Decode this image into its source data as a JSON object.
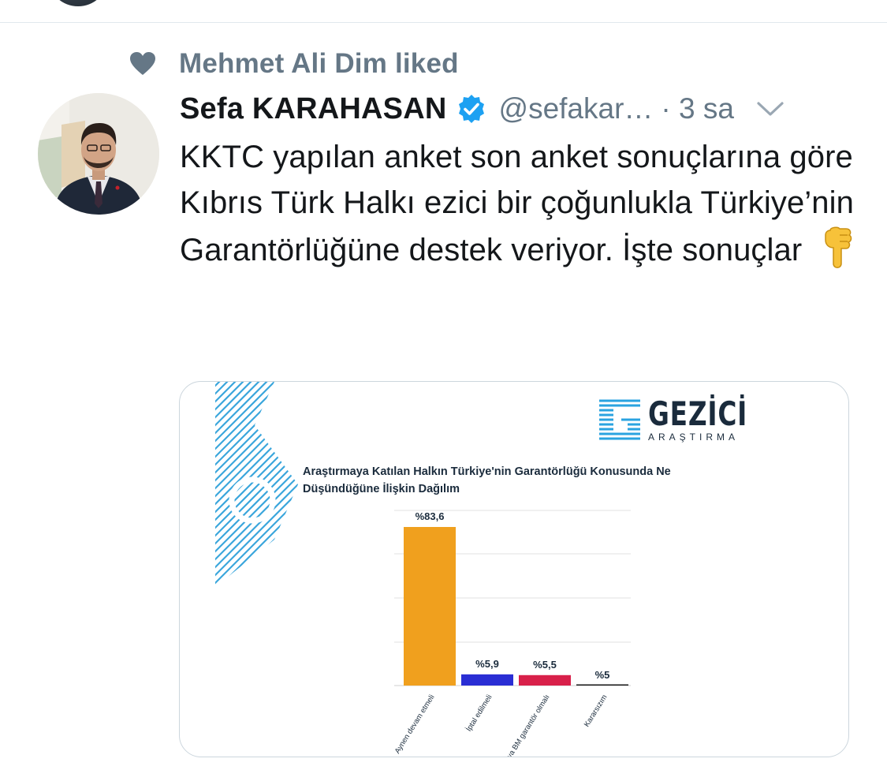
{
  "context": {
    "text": "Mehmet Ali Dim liked",
    "icon": "heart-icon"
  },
  "tweet": {
    "author_name": "Sefa KARAHASAN",
    "verified": true,
    "handle": "@sefakar…",
    "time": "· 3 sa",
    "text": "KKTC yapılan anket son anket sonuçlarına göre Kıbrıs Türk Halkı ezici bir çoğunlukla Türkiye’nin Garantörlüğüne destek veriyor. İşte sonuçlar",
    "emoji": "backhand-index-pointing-down"
  },
  "media": {
    "logo": {
      "name": "GEZİCİ",
      "sub": "ARAŞTIRMA"
    }
  },
  "chart_data": {
    "type": "bar",
    "title": "Araştırmaya Katılan Halkın Türkiye'nin Garantörlüğü Konusunda Ne Düşündüğüne İlişkin Dağılım",
    "categories": [
      "Aynen devam etmeli",
      "İptal edilmeli",
      "...ya BM garantör olmalı",
      "Kararsızım"
    ],
    "values": [
      83.6,
      5.9,
      5.5,
      5
    ],
    "labels": [
      "%83,6",
      "%5,9",
      "%5,5",
      "%5"
    ],
    "colors": [
      "#f0a01e",
      "#2a2ed4",
      "#d8204a",
      "#1a1a1a"
    ],
    "ylim": [
      0,
      100
    ],
    "grid": true,
    "legend": "none"
  },
  "colors": {
    "accent": "#1da1f2",
    "muted": "#657786",
    "text": "#14171a",
    "border": "#ccd6dd"
  }
}
